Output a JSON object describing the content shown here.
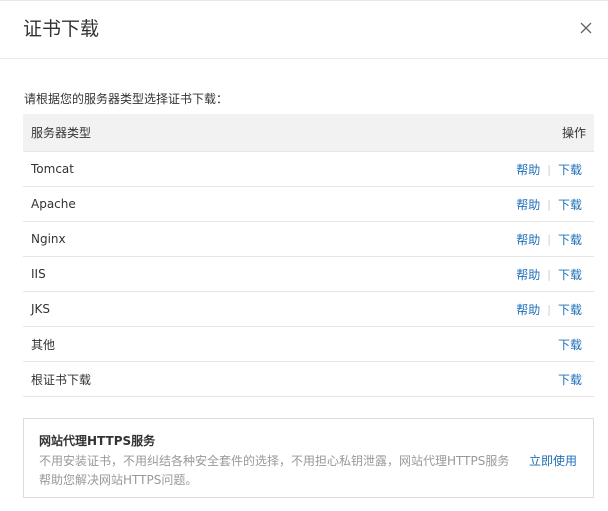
{
  "dialog": {
    "title": "证书下载",
    "close_icon": "close-icon"
  },
  "instruction": "请根据您的服务器类型选择证书下载：",
  "table": {
    "header": {
      "server_type": "服务器类型",
      "operation": "操作"
    },
    "rows": [
      {
        "name": "Tomcat",
        "help": "帮助",
        "download": "下载"
      },
      {
        "name": "Apache",
        "help": "帮助",
        "download": "下载"
      },
      {
        "name": "Nginx",
        "help": "帮助",
        "download": "下载"
      },
      {
        "name": "IIS",
        "help": "帮助",
        "download": "下载"
      },
      {
        "name": "JKS",
        "help": "帮助",
        "download": "下载"
      },
      {
        "name": "其他",
        "download": "下载"
      },
      {
        "name": "根证书下载",
        "download": "下载"
      }
    ],
    "separator": "|"
  },
  "promo": {
    "title": "网站代理HTTPS服务",
    "description": "不用安装证书，不用纠结各种安全套件的选择，不用担心私钥泄露，网站代理HTTPS服务帮助您解决网站HTTPS问题。",
    "cta": "立即使用"
  },
  "colors": {
    "link": "#1e6fb8",
    "muted": "#999999",
    "header_bg": "#f2f2f2"
  }
}
